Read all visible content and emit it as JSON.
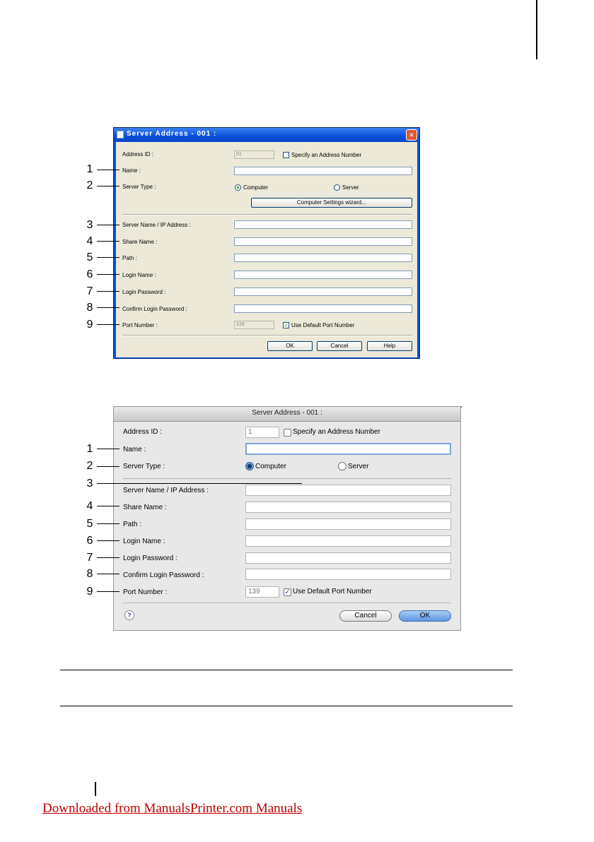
{
  "windows_dialog": {
    "title": "Server Address - 001 :",
    "close_symbol": "×",
    "address_id_label": "Address ID :",
    "address_id_value": "01",
    "specify_address_label": "Specify an Address Number",
    "name_label": "Name :",
    "server_type_label": "Server Type :",
    "computer_label": "Computer",
    "server_label": "Server",
    "wizard_button": "Computer Settings wizard...",
    "server_name_label": "Server Name / IP Address :",
    "share_name_label": "Share Name :",
    "path_label": "Path :",
    "login_name_label": "Login Name :",
    "login_password_label": "Login Password :",
    "confirm_password_label": "Confirm Login Password :",
    "port_number_label": "Port Number :",
    "port_number_value": "139",
    "use_default_port_label": "Use Default Port Number",
    "ok_button": "OK",
    "cancel_button": "Cancel",
    "help_button": "Help",
    "checkmark": "✓"
  },
  "mac_dialog": {
    "title": "Server Address - 001 :",
    "address_id_label": "Address ID :",
    "address_id_value": "1",
    "specify_address_label": "Specify an Address Number",
    "name_label": "Name :",
    "server_type_label": "Server Type :",
    "computer_label": "Computer",
    "server_label": "Server",
    "server_name_label": "Server Name / IP Address :",
    "share_name_label": "Share Name :",
    "path_label": "Path :",
    "login_name_label": "Login Name :",
    "login_password_label": "Login Password :",
    "confirm_password_label": "Confirm Login Password :",
    "port_number_label": "Port Number :",
    "port_number_value": "139",
    "use_default_port_label": "Use Default Port Number",
    "help_symbol": "?",
    "cancel_button": "Cancel",
    "ok_button": "OK",
    "checkmark": "✓"
  },
  "callouts_win": [
    "1",
    "2",
    "3",
    "4",
    "5",
    "6",
    "7",
    "8",
    "9"
  ],
  "callouts_mac": [
    "1",
    "2",
    "3",
    "4",
    "5",
    "6",
    "7",
    "8",
    "9"
  ],
  "footer_link": "Downloaded from ManualsPrinter.com Manuals",
  "colors": {
    "link": "#c00000",
    "xp_title": "#0a4ed8",
    "mac_default_button": "#5d97e0"
  }
}
